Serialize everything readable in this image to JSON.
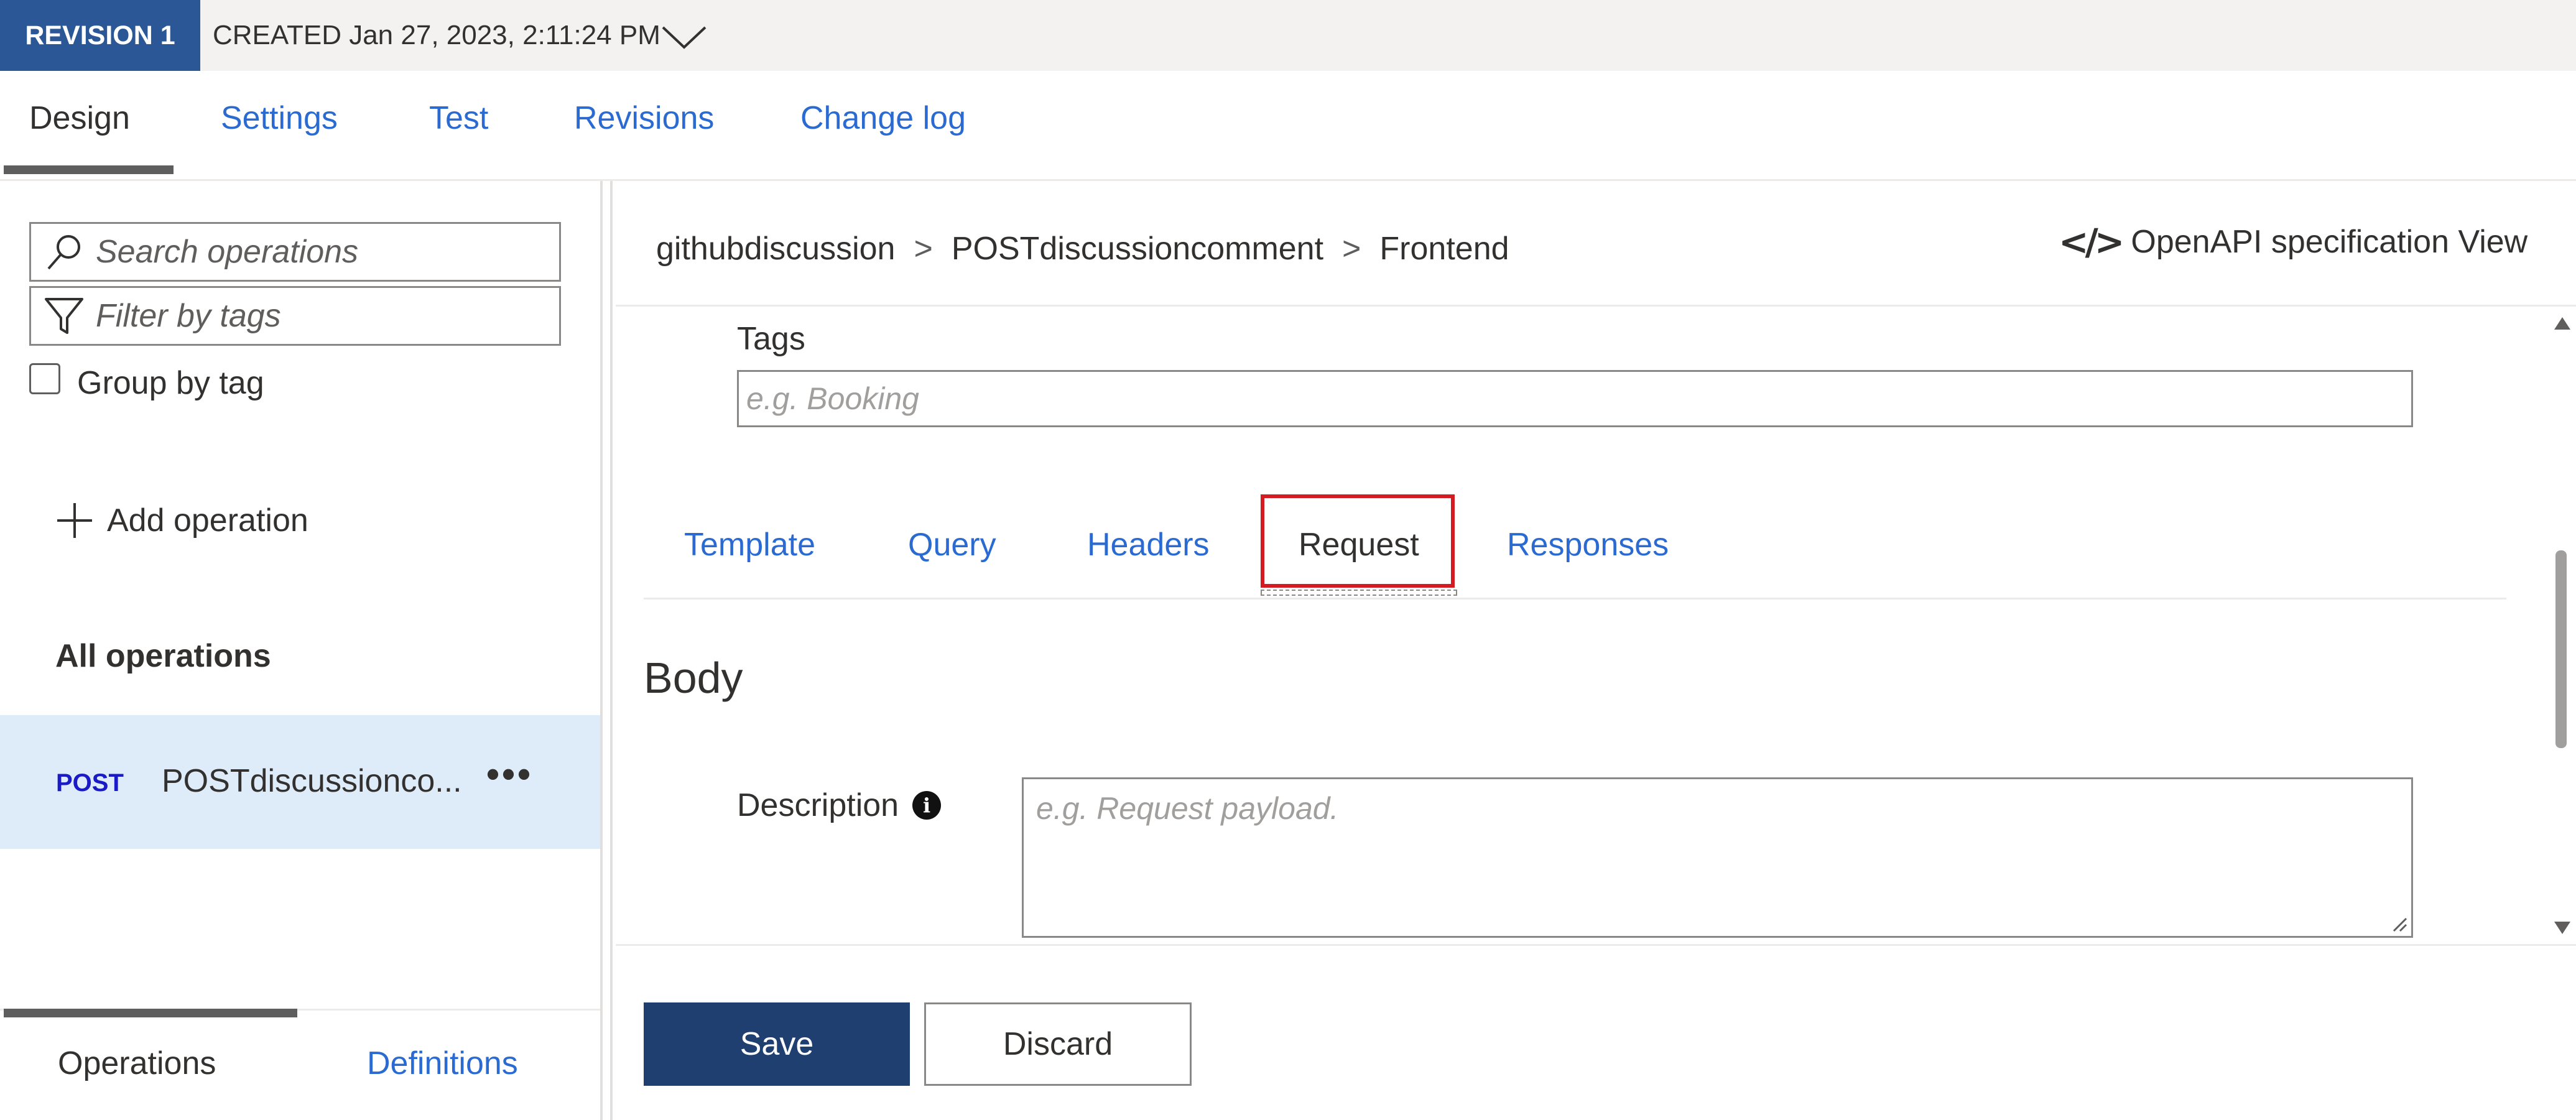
{
  "revision": {
    "badge": "REVISION 1",
    "created": "CREATED Jan 27, 2023, 2:11:24 PM"
  },
  "top_tabs": [
    {
      "label": "Design",
      "active": true
    },
    {
      "label": "Settings",
      "active": false
    },
    {
      "label": "Test",
      "active": false
    },
    {
      "label": "Revisions",
      "active": false
    },
    {
      "label": "Change log",
      "active": false
    }
  ],
  "sidebar": {
    "search_placeholder": "Search operations",
    "filter_placeholder": "Filter by tags",
    "group_by_tag_label": "Group by tag",
    "group_by_tag_checked": false,
    "add_operation_label": "Add operation",
    "all_operations_label": "All operations",
    "operations": [
      {
        "method": "POST",
        "name": "POSTdiscussionco...",
        "more": "•••",
        "selected": true
      }
    ],
    "bottom_tabs": [
      {
        "label": "Operations",
        "active": true
      },
      {
        "label": "Definitions",
        "active": false
      }
    ]
  },
  "breadcrumb": {
    "items": [
      "githubdiscussion",
      "POSTdiscussioncomment",
      "Frontend"
    ],
    "separator": ">"
  },
  "openapi_link": {
    "glyph": "</>",
    "label": "OpenAPI specification View"
  },
  "form": {
    "tags_label": "Tags",
    "tags_placeholder": "e.g. Booking",
    "sub_tabs": [
      {
        "label": "Template",
        "active": false
      },
      {
        "label": "Query",
        "active": false
      },
      {
        "label": "Headers",
        "active": false
      },
      {
        "label": "Request",
        "active": true,
        "highlighted": true
      },
      {
        "label": "Responses",
        "active": false
      }
    ],
    "body_heading": "Body",
    "description_label": "Description",
    "description_info_glyph": "i",
    "description_placeholder": "e.g. Request payload."
  },
  "actions": {
    "save_label": "Save",
    "discard_label": "Discard"
  },
  "colors": {
    "revision_badge": "#2b5797",
    "link": "#2b6bd1",
    "selected_row": "#deecf9",
    "post_method": "#1a1ac7",
    "highlight_box": "#d41b21",
    "save_button": "#1e3f6f"
  },
  "icons": {
    "search": "search-icon",
    "filter": "filter-icon",
    "add": "plus-icon",
    "chevron": "chevron-down-icon",
    "info": "info-icon",
    "code": "code-icon"
  }
}
